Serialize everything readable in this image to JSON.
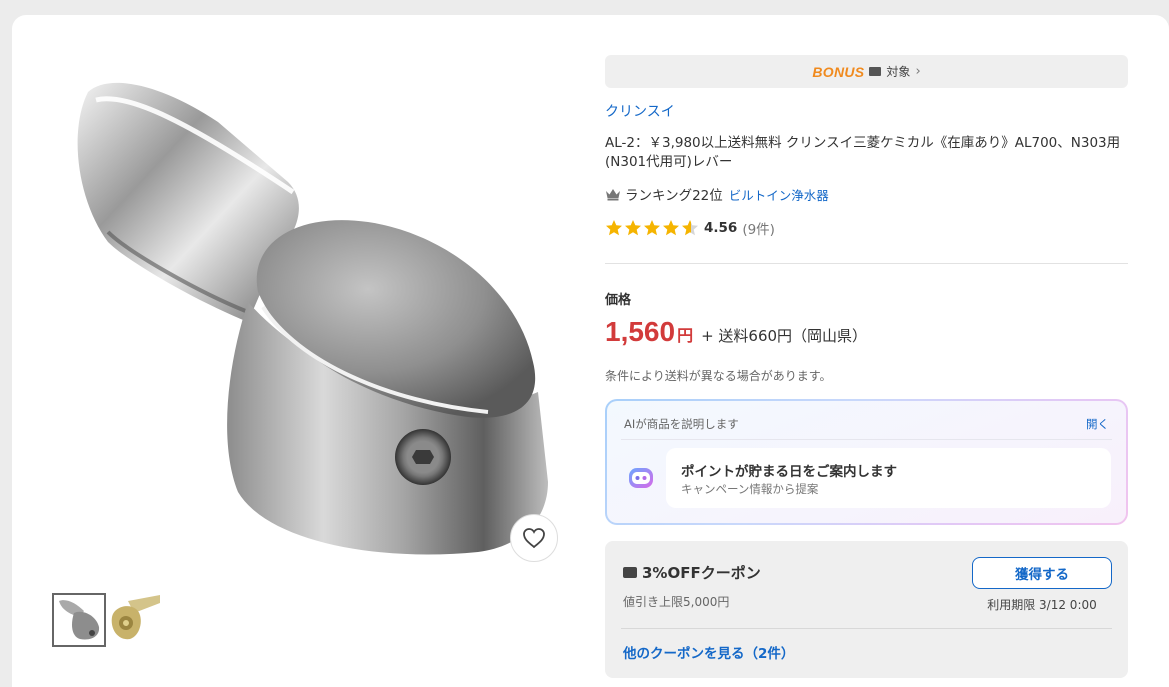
{
  "bonus_bar": {
    "logo_text": "BONUS",
    "label": "対象",
    "chevron": "chevron-right-icon"
  },
  "product": {
    "brand": "クリンスイ",
    "title": "AL-2：￥3,980以上送料無料 クリンスイ三菱ケミカル《在庫あり》AL700、N303用(N301代用可)レバー",
    "ranking_text": "ランキング22位",
    "ranking_category": "ビルトイン浄水器",
    "rating_score": "4.56",
    "rating_value": 4.56,
    "rating_count": "(9件)"
  },
  "price": {
    "label": "価格",
    "amount": "1,560",
    "unit": "円",
    "shipping": "+ 送料660円（岡山県）",
    "shipping_note": "条件により送料が異なる場合があります。"
  },
  "ai": {
    "header": "AIが商品を説明します",
    "open_label": "開く",
    "title": "ポイントが貯まる日をご案内します",
    "subtitle": "キャンペーン情報から提案"
  },
  "coupon": {
    "title": "3%OFFクーポン",
    "limit": "値引き上限5,000円",
    "claim_label": "獲得する",
    "expiry": "利用期限 3/12 0:00",
    "more_link": "他のクーポンを見る（2件）"
  },
  "gallery": {
    "main_image": "chrome-faucet-lever-image",
    "thumbnails": [
      "chrome-lever-thumbnail",
      "gold-lever-thumbnail"
    ],
    "favorite_icon": "heart-icon"
  },
  "colors": {
    "price_red": "#d23b3b",
    "link_blue": "#1468c8",
    "bonus_orange": "#f08a1e",
    "star_gold": "#f5b400"
  }
}
